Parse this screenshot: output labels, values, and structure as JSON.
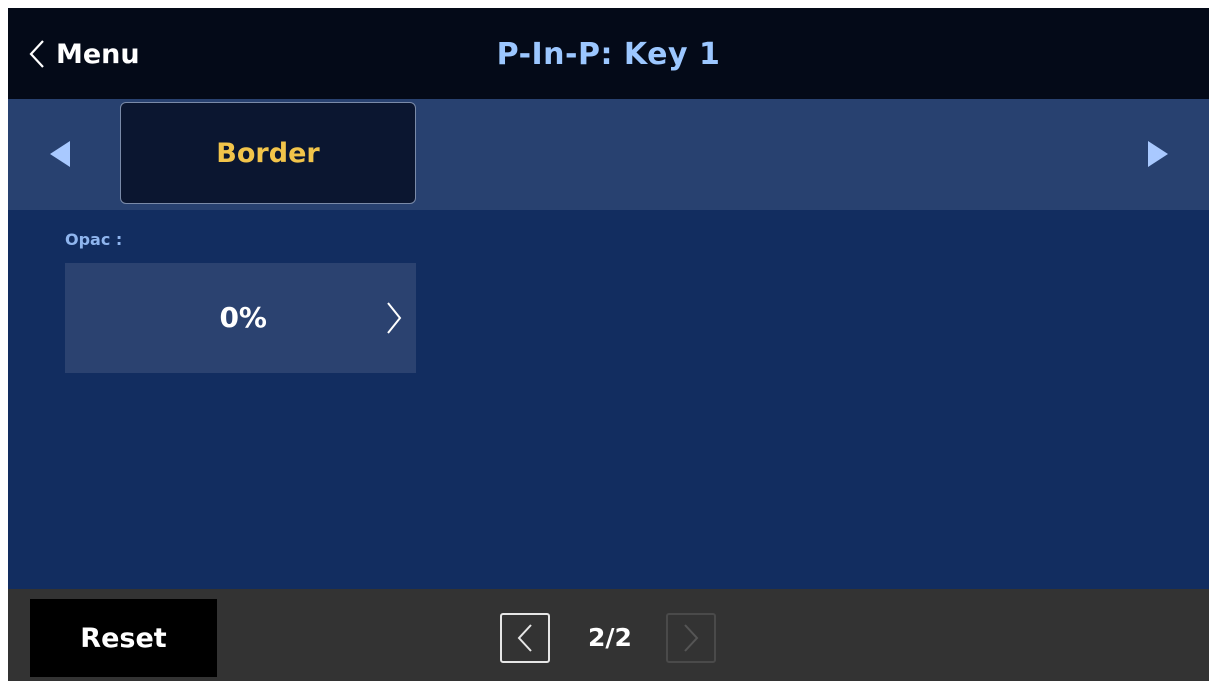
{
  "header": {
    "back_label": "Menu",
    "title": "P-In-P: Key 1"
  },
  "tabs": {
    "active_label": "Border"
  },
  "field": {
    "label": "Opac :",
    "value": "0%"
  },
  "footer": {
    "reset_label": "Reset",
    "page_indicator": "2/2"
  },
  "icons": {
    "back": "chevron-left-icon",
    "tab_prev": "triangle-left-icon",
    "tab_next": "triangle-right-icon",
    "value": "chevron-right-icon",
    "page_prev": "chevron-left-icon",
    "page_next": "chevron-right-icon"
  },
  "colors": {
    "header_bg": "#040a18",
    "title": "#9cc7ff",
    "tab_strip_bg": "#284170",
    "active_tab_text": "#f2c44a",
    "content_bg": "#122d60",
    "footer_bg": "#333333"
  }
}
